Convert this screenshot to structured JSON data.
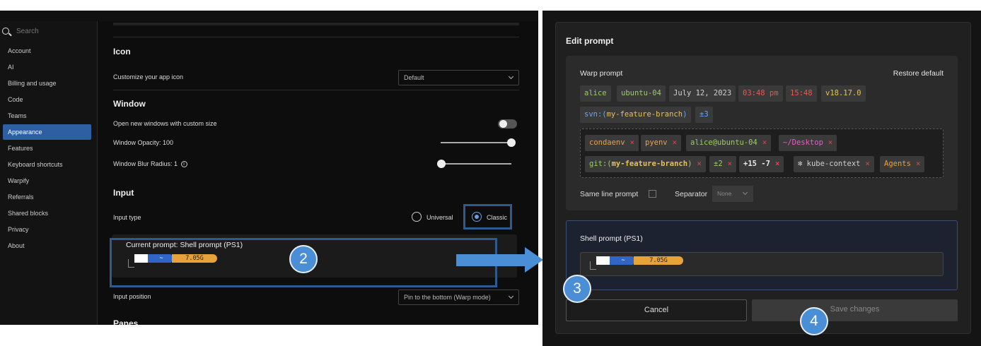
{
  "settings": {
    "search_placeholder": "Search",
    "nav": [
      "Account",
      "AI",
      "Billing and usage",
      "Code",
      "Teams",
      "Appearance",
      "Features",
      "Keyboard shortcuts",
      "Warpify",
      "Referrals",
      "Shared blocks",
      "Privacy",
      "About"
    ],
    "active_nav": "Appearance",
    "icon_section": {
      "title": "Icon",
      "customize_label": "Customize your app icon",
      "icon_value": "Default"
    },
    "window_section": {
      "title": "Window",
      "custom_size_label": "Open new windows with custom size",
      "custom_size_on": false,
      "opacity_label": "Window Opacity: 100",
      "opacity_value": 100,
      "blur_label": "Window Blur Radius: 1",
      "blur_value": 1,
      "info_glyph": "i"
    },
    "input_section": {
      "title": "Input",
      "input_type_label": "Input type",
      "options": [
        "Universal",
        "Classic"
      ],
      "selected": "Classic",
      "current_prompt_label": "Current prompt: Shell prompt (PS1)",
      "input_position_label": "Input position",
      "input_position_value": "Pin to the bottom (Warp mode)"
    },
    "next_section_title": "Panes"
  },
  "ps1": {
    "tilde": "~",
    "size": "7.05G"
  },
  "callouts": {
    "c2": "2",
    "c3": "3",
    "c4": "4"
  },
  "edit_prompt": {
    "title": "Edit prompt",
    "warp_prompt_label": "Warp prompt",
    "restore_default": "Restore default",
    "preview_chips": [
      {
        "text": "alice",
        "color": "#9ccc65"
      },
      {
        "text": "ubuntu-04",
        "color": "#9ccc65"
      },
      {
        "text": "July 12, 2023",
        "color": "#d0d0d0"
      },
      {
        "text": "03:48 pm",
        "color": "#e25c4a"
      },
      {
        "text": "15:48",
        "color": "#e25c4a"
      },
      {
        "text": "v18.17.0",
        "color": "#e8c05a"
      },
      {
        "text": "svn:(my-feature-branch)",
        "color": "#6aa6f0",
        "branch_color": "#e8c05a"
      },
      {
        "text": "±3",
        "color": "#6aa6f0"
      }
    ],
    "available_chips": [
      {
        "text": "condaenv",
        "color": "#e8a14a"
      },
      {
        "text": "pyenv",
        "color": "#e8a14a"
      },
      {
        "text": "alice@ubuntu-04",
        "color": "#9ccc65"
      },
      {
        "text": "~/Desktop",
        "color": "#e061c8"
      },
      {
        "text": "git:(my-feature-branch)",
        "color": "#9ccc65"
      },
      {
        "text": "±2",
        "color": "#9ccc65"
      },
      {
        "text": "+15 -7",
        "color": "#e8e8e8"
      },
      {
        "text": "❄ kube-context",
        "color": "#d0d0d0"
      },
      {
        "text": "Agents",
        "color": "#e8a14a"
      }
    ],
    "remove_glyph": "×",
    "same_line_label": "Same line prompt",
    "separator_label": "Separator",
    "separator_value": "None",
    "shell_prompt_label": "Shell prompt (PS1)",
    "cancel": "Cancel",
    "save": "Save changes"
  }
}
